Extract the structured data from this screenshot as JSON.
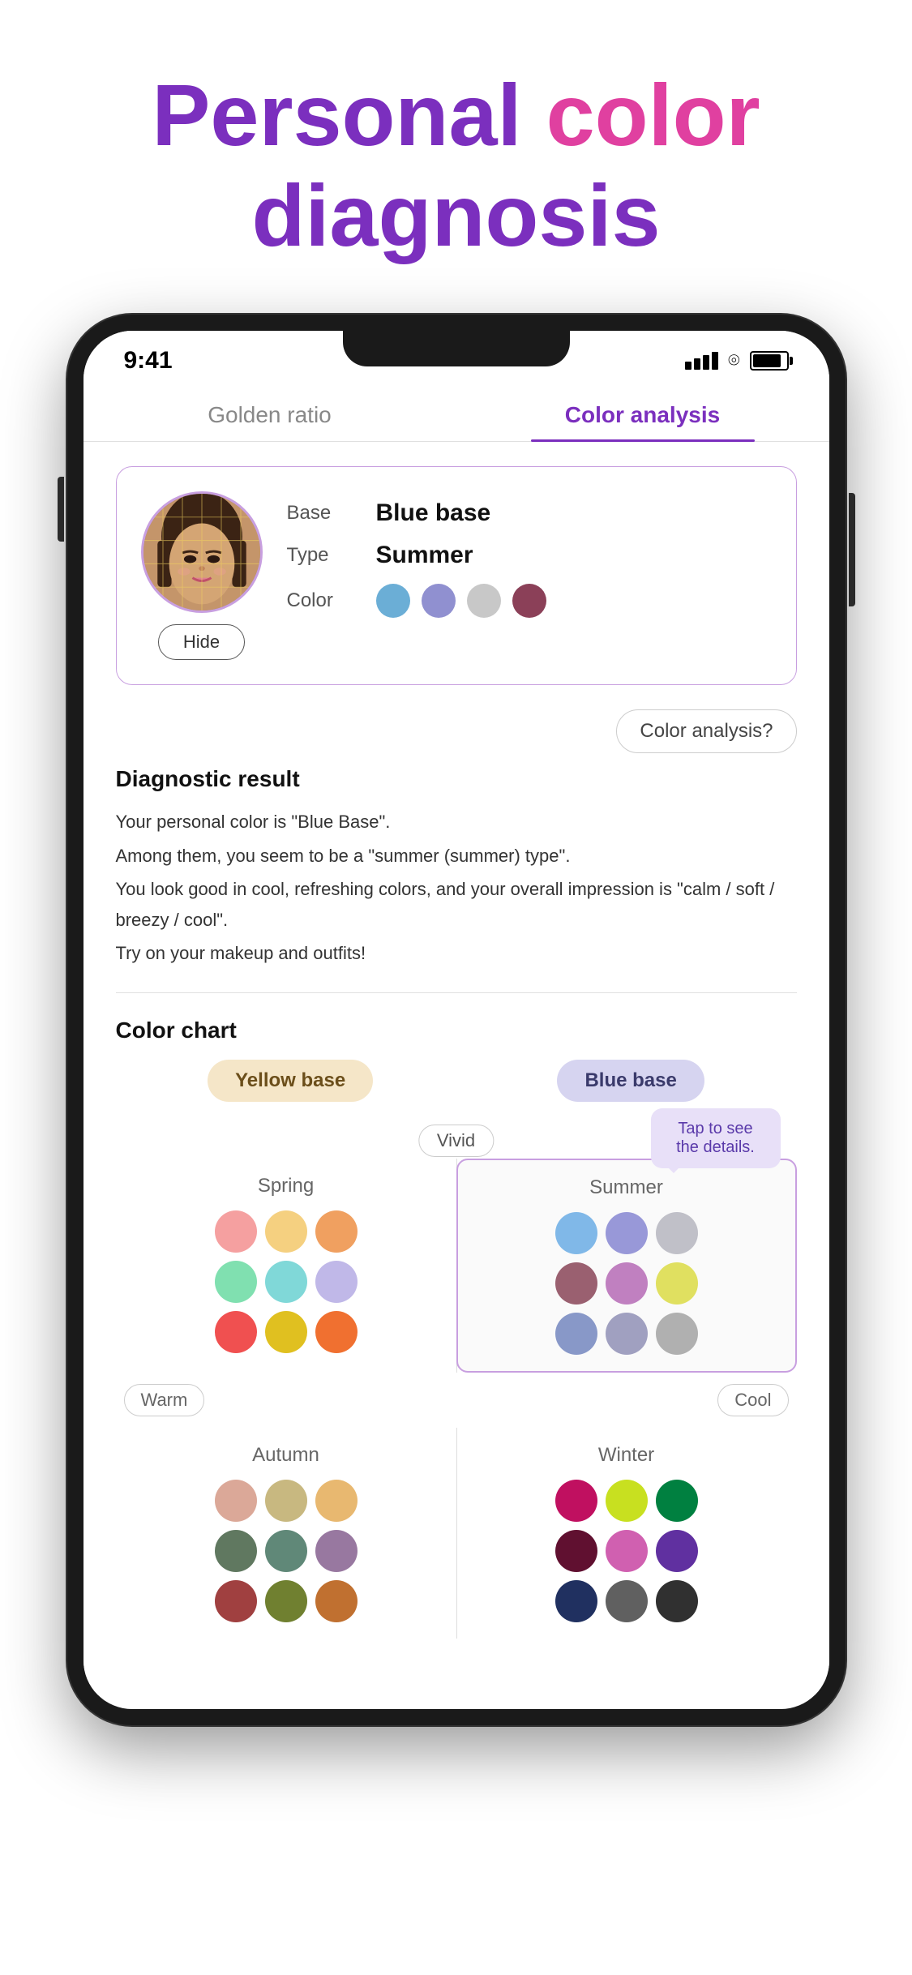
{
  "hero": {
    "line1_part1": "Personal ",
    "line1_part2": "color",
    "line2": "diagnosis"
  },
  "status_bar": {
    "time": "9:41",
    "signal_strength": 4,
    "wifi": true,
    "battery_percent": 85
  },
  "tabs": [
    {
      "id": "golden-ratio",
      "label": "Golden ratio",
      "active": false
    },
    {
      "id": "color-analysis",
      "label": "Color analysis",
      "active": true
    }
  ],
  "profile_card": {
    "base_label": "Base",
    "base_value": "Blue base",
    "type_label": "Type",
    "type_value": "Summer",
    "color_label": "Color",
    "colors": [
      {
        "name": "light-blue",
        "hex": "#6BAED6"
      },
      {
        "name": "periwinkle",
        "hex": "#9090D0"
      },
      {
        "name": "light-gray",
        "hex": "#C8C8C8"
      },
      {
        "name": "mauve",
        "hex": "#8B4058"
      }
    ],
    "hide_button": "Hide"
  },
  "color_analysis_button": "Color analysis?",
  "diagnostic": {
    "title": "Diagnostic result",
    "lines": [
      "Your personal color is \"Blue Base\".",
      "Among them, you seem to be a \"summer (summer) type\".",
      "You look good in cool, refreshing colors, and your overall impression is \"calm / soft / breezy / cool\".",
      "Try on your makeup and outfits!"
    ]
  },
  "color_chart": {
    "title": "Color chart",
    "yellow_base_label": "Yellow base",
    "blue_base_label": "Blue base",
    "vivid_label": "Vivid",
    "warm_label": "Warm",
    "cool_label": "Cool",
    "tap_tooltip": "Tap to see the details.",
    "seasons": {
      "spring": {
        "name": "Spring",
        "colors": [
          "#F5A0A0",
          "#F5D080",
          "#F0A060",
          "#80E0B0",
          "#80D8D8",
          "#C0B8E8",
          "#F05050",
          "#E0C020",
          "#F07030"
        ]
      },
      "summer": {
        "name": "Summer",
        "selected": true,
        "colors": [
          "#80B8E8",
          "#9898D8",
          "#C0C0C8",
          "#9A6070",
          "#C080C0",
          "#E0E060",
          "#8898C8",
          "#A0A0C0",
          "#B0B0B0"
        ]
      },
      "autumn": {
        "name": "Autumn",
        "colors": [
          "#DBA898",
          "#C8B880",
          "#E8B870",
          "#607860",
          "#608878",
          "#9878A0",
          "#A04040",
          "#708030",
          "#C07030"
        ]
      },
      "winter": {
        "name": "Winter",
        "colors": [
          "#C01060",
          "#C8E020",
          "#008040",
          "#601030",
          "#D060B0",
          "#6030A0",
          "#203060",
          "#606060",
          "#303030"
        ]
      }
    }
  }
}
